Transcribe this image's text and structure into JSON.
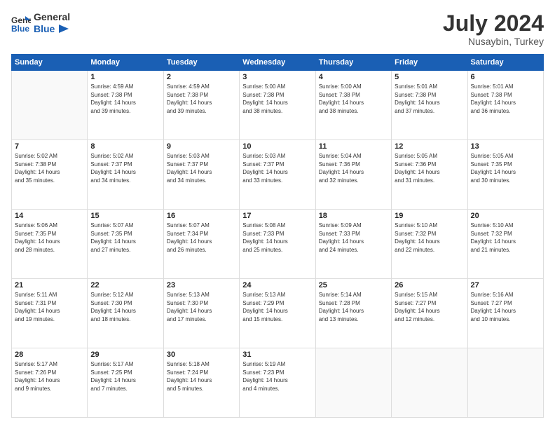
{
  "header": {
    "logo": {
      "general": "General",
      "blue": "Blue"
    },
    "title": "July 2024",
    "location": "Nusaybin, Turkey"
  },
  "calendar": {
    "weekdays": [
      "Sunday",
      "Monday",
      "Tuesday",
      "Wednesday",
      "Thursday",
      "Friday",
      "Saturday"
    ],
    "weeks": [
      [
        {
          "day": null,
          "info": ""
        },
        {
          "day": "1",
          "info": "Sunrise: 4:59 AM\nSunset: 7:38 PM\nDaylight: 14 hours\nand 39 minutes."
        },
        {
          "day": "2",
          "info": "Sunrise: 4:59 AM\nSunset: 7:38 PM\nDaylight: 14 hours\nand 39 minutes."
        },
        {
          "day": "3",
          "info": "Sunrise: 5:00 AM\nSunset: 7:38 PM\nDaylight: 14 hours\nand 38 minutes."
        },
        {
          "day": "4",
          "info": "Sunrise: 5:00 AM\nSunset: 7:38 PM\nDaylight: 14 hours\nand 38 minutes."
        },
        {
          "day": "5",
          "info": "Sunrise: 5:01 AM\nSunset: 7:38 PM\nDaylight: 14 hours\nand 37 minutes."
        },
        {
          "day": "6",
          "info": "Sunrise: 5:01 AM\nSunset: 7:38 PM\nDaylight: 14 hours\nand 36 minutes."
        }
      ],
      [
        {
          "day": "7",
          "info": "Sunrise: 5:02 AM\nSunset: 7:38 PM\nDaylight: 14 hours\nand 35 minutes."
        },
        {
          "day": "8",
          "info": "Sunrise: 5:02 AM\nSunset: 7:37 PM\nDaylight: 14 hours\nand 34 minutes."
        },
        {
          "day": "9",
          "info": "Sunrise: 5:03 AM\nSunset: 7:37 PM\nDaylight: 14 hours\nand 34 minutes."
        },
        {
          "day": "10",
          "info": "Sunrise: 5:03 AM\nSunset: 7:37 PM\nDaylight: 14 hours\nand 33 minutes."
        },
        {
          "day": "11",
          "info": "Sunrise: 5:04 AM\nSunset: 7:36 PM\nDaylight: 14 hours\nand 32 minutes."
        },
        {
          "day": "12",
          "info": "Sunrise: 5:05 AM\nSunset: 7:36 PM\nDaylight: 14 hours\nand 31 minutes."
        },
        {
          "day": "13",
          "info": "Sunrise: 5:05 AM\nSunset: 7:35 PM\nDaylight: 14 hours\nand 30 minutes."
        }
      ],
      [
        {
          "day": "14",
          "info": "Sunrise: 5:06 AM\nSunset: 7:35 PM\nDaylight: 14 hours\nand 28 minutes."
        },
        {
          "day": "15",
          "info": "Sunrise: 5:07 AM\nSunset: 7:35 PM\nDaylight: 14 hours\nand 27 minutes."
        },
        {
          "day": "16",
          "info": "Sunrise: 5:07 AM\nSunset: 7:34 PM\nDaylight: 14 hours\nand 26 minutes."
        },
        {
          "day": "17",
          "info": "Sunrise: 5:08 AM\nSunset: 7:33 PM\nDaylight: 14 hours\nand 25 minutes."
        },
        {
          "day": "18",
          "info": "Sunrise: 5:09 AM\nSunset: 7:33 PM\nDaylight: 14 hours\nand 24 minutes."
        },
        {
          "day": "19",
          "info": "Sunrise: 5:10 AM\nSunset: 7:32 PM\nDaylight: 14 hours\nand 22 minutes."
        },
        {
          "day": "20",
          "info": "Sunrise: 5:10 AM\nSunset: 7:32 PM\nDaylight: 14 hours\nand 21 minutes."
        }
      ],
      [
        {
          "day": "21",
          "info": "Sunrise: 5:11 AM\nSunset: 7:31 PM\nDaylight: 14 hours\nand 19 minutes."
        },
        {
          "day": "22",
          "info": "Sunrise: 5:12 AM\nSunset: 7:30 PM\nDaylight: 14 hours\nand 18 minutes."
        },
        {
          "day": "23",
          "info": "Sunrise: 5:13 AM\nSunset: 7:30 PM\nDaylight: 14 hours\nand 17 minutes."
        },
        {
          "day": "24",
          "info": "Sunrise: 5:13 AM\nSunset: 7:29 PM\nDaylight: 14 hours\nand 15 minutes."
        },
        {
          "day": "25",
          "info": "Sunrise: 5:14 AM\nSunset: 7:28 PM\nDaylight: 14 hours\nand 13 minutes."
        },
        {
          "day": "26",
          "info": "Sunrise: 5:15 AM\nSunset: 7:27 PM\nDaylight: 14 hours\nand 12 minutes."
        },
        {
          "day": "27",
          "info": "Sunrise: 5:16 AM\nSunset: 7:27 PM\nDaylight: 14 hours\nand 10 minutes."
        }
      ],
      [
        {
          "day": "28",
          "info": "Sunrise: 5:17 AM\nSunset: 7:26 PM\nDaylight: 14 hours\nand 9 minutes."
        },
        {
          "day": "29",
          "info": "Sunrise: 5:17 AM\nSunset: 7:25 PM\nDaylight: 14 hours\nand 7 minutes."
        },
        {
          "day": "30",
          "info": "Sunrise: 5:18 AM\nSunset: 7:24 PM\nDaylight: 14 hours\nand 5 minutes."
        },
        {
          "day": "31",
          "info": "Sunrise: 5:19 AM\nSunset: 7:23 PM\nDaylight: 14 hours\nand 4 minutes."
        },
        {
          "day": null,
          "info": ""
        },
        {
          "day": null,
          "info": ""
        },
        {
          "day": null,
          "info": ""
        }
      ]
    ]
  }
}
